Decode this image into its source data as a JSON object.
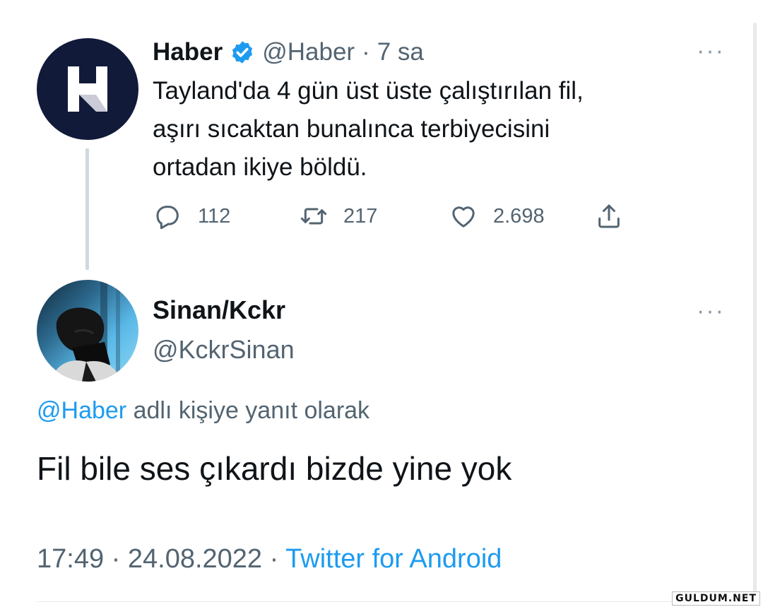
{
  "original_tweet": {
    "author_name": "Haber",
    "verified_icon": "verified-badge-icon",
    "handle": "@Haber",
    "separator": "·",
    "time_ago": "7 sa",
    "text_line1": "Tayland'da 4 gün üst üste çalıştırılan fil,",
    "text_line2": "aşırı sıcaktan bunalınca terbiyecisini",
    "text_line3": "ortadan ikiye böldü.",
    "actions": {
      "reply_count": "112",
      "retweet_count": "217",
      "like_count": "2.698"
    },
    "more_label": "···"
  },
  "reply_tweet": {
    "author_name": "Sinan/Kckr",
    "handle": "@KckrSinan",
    "more_label": "···",
    "reply_to_mention": "@Haber",
    "reply_to_suffix": " adlı kişiye yanıt olarak",
    "text": "Fil bile ses çıkardı bizde yine yok",
    "time": "17:49",
    "separator": " · ",
    "date": "24.08.2022",
    "separator2": " · ",
    "source": "Twitter for Android"
  },
  "watermark": "GULDUM.NET",
  "colors": {
    "accent": "#1d9bf0",
    "secondary_text": "#536471",
    "primary_text": "#0f1419",
    "haber_avatar_bg": "#121a3a"
  }
}
